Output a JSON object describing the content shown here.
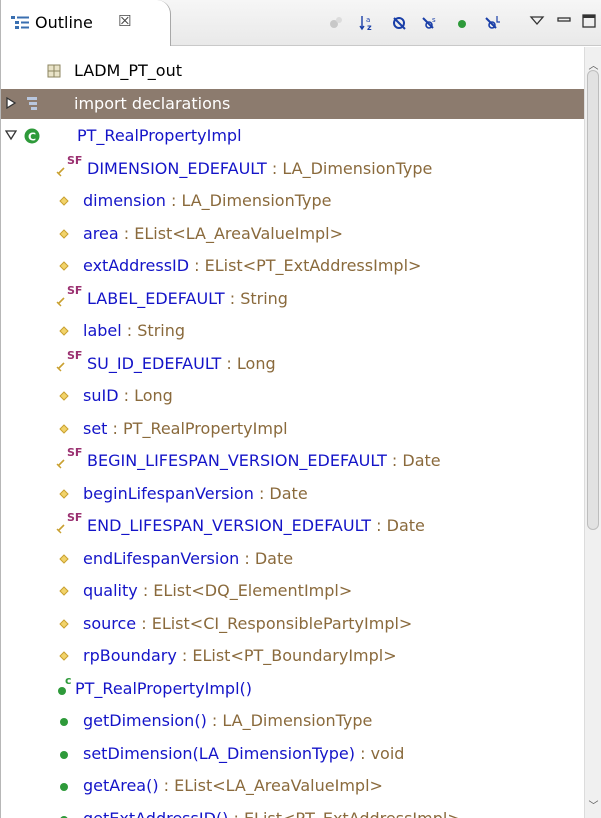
{
  "view": {
    "title": "Outline",
    "close_glyph": "☒"
  },
  "toolbar": {
    "icons": [
      "hide-fields-icon",
      "sort-alphabetically-icon",
      "hide-static-icon",
      "hide-non-public-icon",
      "hide-local-types-icon",
      "link-with-editor-icon",
      "view-menu-icon",
      "minimize-icon",
      "maximize-icon"
    ]
  },
  "colors": {
    "selection": "#8c7b6e",
    "member_name": "#1414c8",
    "member_type": "#8a6a3c",
    "public_method": "#2e9a3a",
    "field_private": "#c9a030"
  },
  "tree": [
    {
      "name": "LADM_PT_out",
      "type": "",
      "kind": "package",
      "indent": 0
    },
    {
      "name": "import declarations",
      "type": "",
      "kind": "imports",
      "indent": 0,
      "selected": true
    },
    {
      "name": "PT_RealPropertyImpl",
      "type": "",
      "kind": "class",
      "indent": 0,
      "expanded": true
    },
    {
      "name": "DIMENSION_EDEFAULT",
      "type": " : LA_DimensionType",
      "kind": "static-final",
      "indent": 1
    },
    {
      "name": "dimension",
      "type": " : LA_DimensionType",
      "kind": "protected-field",
      "indent": 1
    },
    {
      "name": "area",
      "type": " : EList<LA_AreaValueImpl>",
      "kind": "protected-field",
      "indent": 1
    },
    {
      "name": "extAddressID",
      "type": " : EList<PT_ExtAddressImpl>",
      "kind": "protected-field",
      "indent": 1
    },
    {
      "name": "LABEL_EDEFAULT",
      "type": " : String",
      "kind": "static-final",
      "indent": 1
    },
    {
      "name": "label",
      "type": " : String",
      "kind": "protected-field",
      "indent": 1
    },
    {
      "name": "SU_ID_EDEFAULT",
      "type": " : Long",
      "kind": "static-final",
      "indent": 1
    },
    {
      "name": "suID",
      "type": " : Long",
      "kind": "protected-field",
      "indent": 1
    },
    {
      "name": "set",
      "type": " : PT_RealPropertyImpl",
      "kind": "protected-field",
      "indent": 1
    },
    {
      "name": "BEGIN_LIFESPAN_VERSION_EDEFAULT",
      "type": " : Date",
      "kind": "static-final",
      "indent": 1
    },
    {
      "name": "beginLifespanVersion",
      "type": " : Date",
      "kind": "protected-field",
      "indent": 1
    },
    {
      "name": "END_LIFESPAN_VERSION_EDEFAULT",
      "type": " : Date",
      "kind": "static-final",
      "indent": 1
    },
    {
      "name": "endLifespanVersion",
      "type": " : Date",
      "kind": "protected-field",
      "indent": 1
    },
    {
      "name": "quality",
      "type": " : EList<DQ_ElementImpl>",
      "kind": "protected-field",
      "indent": 1
    },
    {
      "name": "source",
      "type": " : EList<CI_ResponsiblePartyImpl>",
      "kind": "protected-field",
      "indent": 1
    },
    {
      "name": "rpBoundary",
      "type": " : EList<PT_BoundaryImpl>",
      "kind": "protected-field",
      "indent": 1
    },
    {
      "name": "PT_RealPropertyImpl()",
      "type": "",
      "kind": "constructor",
      "indent": 1
    },
    {
      "name": "getDimension()",
      "type": " : LA_DimensionType",
      "kind": "public-method",
      "indent": 1
    },
    {
      "name": "setDimension(LA_DimensionType)",
      "type": " : void",
      "kind": "public-method",
      "indent": 1
    },
    {
      "name": "getArea()",
      "type": " : EList<LA_AreaValueImpl>",
      "kind": "public-method",
      "indent": 1
    },
    {
      "name": "getExtAddressID()",
      "type": " : EList<PT_ExtAddressImpl>",
      "kind": "public-method",
      "indent": 1
    }
  ]
}
